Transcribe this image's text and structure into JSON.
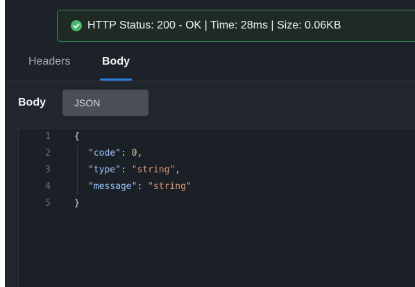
{
  "status": {
    "message": "HTTP Status: 200 - OK | Time: 28ms | Size: 0.06KB",
    "icon": "check-circle-icon",
    "accent": "#48b86b"
  },
  "tabs": [
    {
      "label": "Headers",
      "active": false
    },
    {
      "label": "Body",
      "active": true
    }
  ],
  "body_panel": {
    "label": "Body",
    "format": "JSON"
  },
  "editor": {
    "lines": [
      {
        "number": "1",
        "open": "{"
      },
      {
        "number": "2",
        "key": "\"code\"",
        "colon": ": ",
        "value": "0",
        "trail": ","
      },
      {
        "number": "3",
        "key": "\"type\"",
        "colon": ": ",
        "value": "\"string\"",
        "trail": ","
      },
      {
        "number": "4",
        "key": "\"message\"",
        "colon": ": ",
        "value": "\"string\"",
        "trail": ""
      },
      {
        "number": "5",
        "close": "}"
      }
    ]
  },
  "colors": {
    "background": "#20252e",
    "panel": "#1b1f26",
    "tab_active_indicator": "#2f7fe0",
    "string_value": "#d89a7d",
    "numeric_value": "#c8d59f",
    "json_key": "#9ec9ff"
  }
}
